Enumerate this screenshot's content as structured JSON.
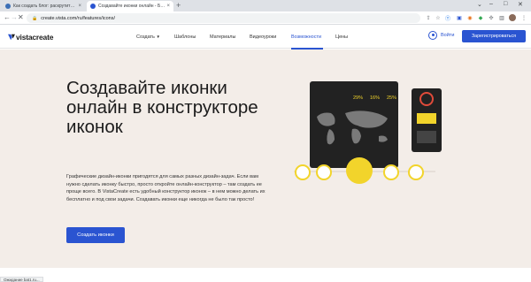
{
  "browser": {
    "tabs": [
      {
        "title": "Как создать блог: раскрутить с...",
        "active": false
      },
      {
        "title": "Создавайте иконки онлайн - Бес...",
        "active": true
      }
    ],
    "new_tab_symbol": "+",
    "close_symbol": "×",
    "url": "create.vista.com/ru/features/icons/",
    "status_text": "Ожидание bat1.ru..."
  },
  "header": {
    "logo_text": "vistacreate",
    "nav": [
      {
        "label": "Создать",
        "has_caret": true,
        "active": false
      },
      {
        "label": "Шаблоны",
        "active": false
      },
      {
        "label": "Материалы",
        "active": false
      },
      {
        "label": "Видеоуроки",
        "active": false
      },
      {
        "label": "Возможности",
        "active": true
      },
      {
        "label": "Цены",
        "active": false
      }
    ],
    "login_label": "Войти",
    "signup_label": "Зарегистрироваться"
  },
  "hero": {
    "title": "Создавайте иконки онлайн в конструкторе иконок",
    "description": "Графические дизайн-иконки пригодятся для самых разных дизайн-задач. Если вам нужно сделать иконку быстро, просто откройте онлайн-конструктор – там создать ее проще всего. В VistaCreate есть удобный конструктор иконок – в нем можно делать их бесплатно и под свои задачи. Создавать иконки еще никогда не было так просто!",
    "cta_label": "Создать иконки"
  },
  "illustration": {
    "stats": [
      "29%",
      "16%",
      "25%"
    ]
  },
  "colors": {
    "brand_blue": "#2a54d1",
    "hero_bg": "#f3ede8",
    "accent_yellow": "#f2d42b"
  }
}
